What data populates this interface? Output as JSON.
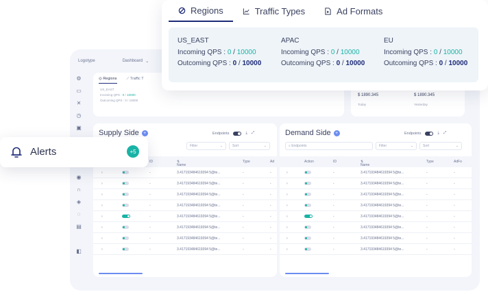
{
  "top_nav": {
    "logo": "Logotype",
    "dashboard": "Dashboard"
  },
  "mini_regions": {
    "tabs": [
      "Regions",
      "Traffic T"
    ],
    "region": "US_EAST",
    "incoming_label": "Incoming QPS :",
    "incoming_value": "0",
    "incoming_max": "10000",
    "outgoing_label": "Outcoming QPS :",
    "outgoing_value": "0",
    "outgoing_max": "10000"
  },
  "stats": [
    {
      "value": "$ 1890.345",
      "label": "Today"
    },
    {
      "value": "$ 1890.345",
      "label": "Yesterday"
    }
  ],
  "regions_popup": {
    "tabs": [
      {
        "label": "Regions",
        "icon": "globe-icon"
      },
      {
        "label": "Traffic Types",
        "icon": "chart-line-icon"
      },
      {
        "label": "Ad Formats",
        "icon": "ad-icon"
      }
    ],
    "regions": [
      {
        "name": "US_EAST",
        "incoming_label": "Incoming QPS :",
        "incoming_value": "0",
        "incoming_max": "10000",
        "outgoing_label": "Outcoming QPS :",
        "outgoing_value": "0",
        "outgoing_max": "10000"
      },
      {
        "name": "APAC",
        "incoming_label": "Incoming QPS :",
        "incoming_value": "0",
        "incoming_max": "10000",
        "outgoing_label": "Outcoming QPS :",
        "outgoing_value": "0",
        "outgoing_max": "10000"
      },
      {
        "name": "EU",
        "incoming_label": "Incoming QPS :",
        "incoming_value": "0",
        "incoming_max": "10000",
        "outgoing_label": "Outcoming QPS :",
        "outgoing_value": "0",
        "outgoing_max": "10000"
      }
    ]
  },
  "alerts": {
    "label": "Alerts",
    "badge": "+5"
  },
  "supply": {
    "title": "Supply Side",
    "endpoints_label": "Endpoints",
    "filter_placeholder": "Filter",
    "sort_placeholder": "Sort",
    "columns": {
      "id": "ID",
      "name": "Name",
      "type": "Type",
      "ad": "Ad"
    }
  },
  "demand": {
    "title": "Demand Side",
    "endpoints_label": "Endpoints",
    "search_placeholder": "Endpoints",
    "filter_placeholder": "Filter",
    "sort_placeholder": "Sort",
    "columns": {
      "action": "Action",
      "id": "ID",
      "name": "Name",
      "type": "Type",
      "ad": "AdFo"
    }
  },
  "table_rows": [
    {
      "name": "3.417193484619394 5@te...",
      "id": "-",
      "type": "-",
      "ad": "-",
      "on": false
    },
    {
      "name": "3.417193484619394 5@te...",
      "id": "-",
      "type": "-",
      "ad": "-",
      "on": false
    },
    {
      "name": "3.417193484619394 5@te...",
      "id": "-",
      "type": "-",
      "ad": "-",
      "on": false
    },
    {
      "name": "3.417193484619394 5@te...",
      "id": "-",
      "type": "-",
      "ad": "-",
      "on": false
    },
    {
      "name": "3.417193484619394 5@te...",
      "id": "-",
      "type": "-",
      "ad": "-",
      "on": true
    },
    {
      "name": "3.417193484619394 5@te...",
      "id": "-",
      "type": "-",
      "ad": "-",
      "on": false
    },
    {
      "name": "3.417193484619394 5@te...",
      "id": "-",
      "type": "-",
      "ad": "-",
      "on": false
    },
    {
      "name": "3.417193484619394 5@te...",
      "id": "-",
      "type": "-",
      "ad": "-",
      "on": false
    }
  ],
  "colors": {
    "accent": "#19b3a6",
    "navy": "#1c2a78",
    "blue": "#6b8cf0"
  }
}
